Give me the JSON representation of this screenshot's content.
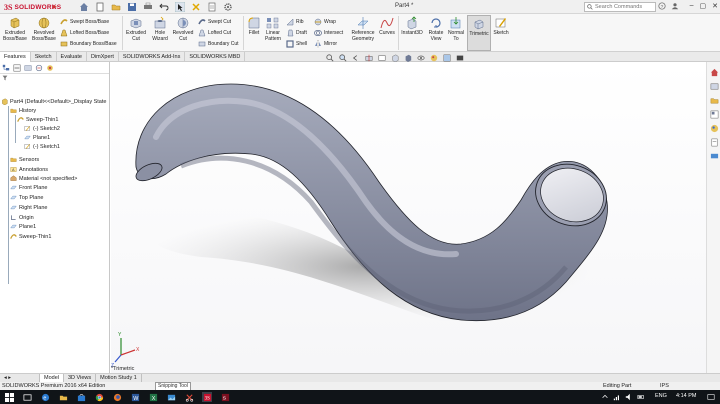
{
  "app": {
    "logo_ds": "3S",
    "logo_name": "SOLIDWORKS",
    "document_title": "Part4 *",
    "search_placeholder": "Search Commands"
  },
  "ribbon": {
    "extruded_boss": "Extruded\nBoss/Base",
    "revolved_boss": "Revolved\nBoss/Base",
    "swept_boss": "Swept Boss/Base",
    "lofted_boss": "Lofted Boss/Base",
    "boundary_boss": "Boundary Boss/Base",
    "extruded_cut": "Extruded\nCut",
    "hole_wizard": "Hole\nWizard",
    "revolved_cut": "Revolved\nCut",
    "swept_cut": "Swept Cut",
    "lofted_cut": "Lofted Cut",
    "boundary_cut": "Boundary Cut",
    "fillet": "Fillet",
    "linear_pattern": "Linear\nPattern",
    "rib": "Rib",
    "draft": "Draft",
    "shell": "Shell",
    "wrap": "Wrap",
    "intersect": "Intersect",
    "mirror": "Mirror",
    "reference_geometry": "Reference\nGeometry",
    "curves": "Curves",
    "instant3d": "Instant3D",
    "rotate_view": "Rotate\nView",
    "normal_to": "Normal\nTo",
    "trimetric": "Trimetric",
    "sketch": "Sketch"
  },
  "tabs": [
    "Features",
    "Sketch",
    "Evaluate",
    "DimXpert",
    "SOLIDWORKS Add-Ins",
    "SOLIDWORKS MBD"
  ],
  "feature_tree": {
    "part": "Part4  (Default<<Default>_Display State",
    "history": "History",
    "sweep_thin_hist": "Sweep-Thin1",
    "sketch2": "(-) Sketch2",
    "plane1_hist": "Plane1",
    "sketch1": "(-) Sketch1",
    "sensors": "Sensors",
    "annotations": "Annotations",
    "material": "Material <not specified>",
    "front_plane": "Front Plane",
    "top_plane": "Top Plane",
    "right_plane": "Right Plane",
    "origin": "Origin",
    "plane1": "Plane1",
    "sweep_thin": "Sweep-Thin1"
  },
  "view_label": "*Trimetric",
  "bottom_tabs": [
    "Model",
    "3D Views",
    "Motion Study 1"
  ],
  "tooltip": "Snipping Tool",
  "status": {
    "edition": "SOLIDWORKS Premium 2016 x64 Edition",
    "mode": "Editing Part",
    "units": "IPS"
  },
  "taskbar": {
    "language": "ENG",
    "time": "4:14 PM"
  },
  "colors": {
    "brand": "#c8102e",
    "model_body": "#8e92a6",
    "model_shadow": "#a0a0a0",
    "taskbar": "#101418"
  }
}
